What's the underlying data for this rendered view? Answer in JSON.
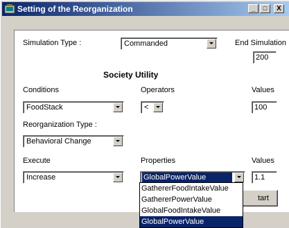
{
  "window": {
    "title": "Setting of the Reorganization",
    "minimize_label": "_",
    "maximize_label": "□",
    "close_label": "X"
  },
  "form": {
    "simulation_type_label": "Simulation Type :",
    "simulation_type_value": "Commanded",
    "end_simulation_label": "End Simulation :",
    "end_simulation_value": "200",
    "section_heading": "Society Utility",
    "conditions_label": "Conditions",
    "conditions_value": "FoodStack",
    "operators_label": "Operators",
    "operators_value": "<",
    "values_label_1": "Values",
    "values_value_1": "100",
    "reorg_type_label": "Reorganization Type :",
    "reorg_type_value": "Behavioral Change",
    "execute_label": "Execute",
    "execute_value": "Increase",
    "properties_label": "Properties",
    "properties_value": "GlobalPowerValue",
    "values_label_2": "Values",
    "values_value_2": "1.1",
    "start_button_label": "tart"
  },
  "properties_dropdown": {
    "options": [
      "GathererFoodIntakeValue",
      "GathererPowerValue",
      "GlobalFoodIntakeValue",
      "GlobalPowerValue"
    ],
    "highlighted_index": 3
  },
  "colors": {
    "titlebar_start": "#0a246a",
    "titlebar_end": "#a6caf0",
    "selection": "#0a246a"
  },
  "icons": {
    "app": "app-icon",
    "combo_arrow": "chevron-down-icon"
  }
}
